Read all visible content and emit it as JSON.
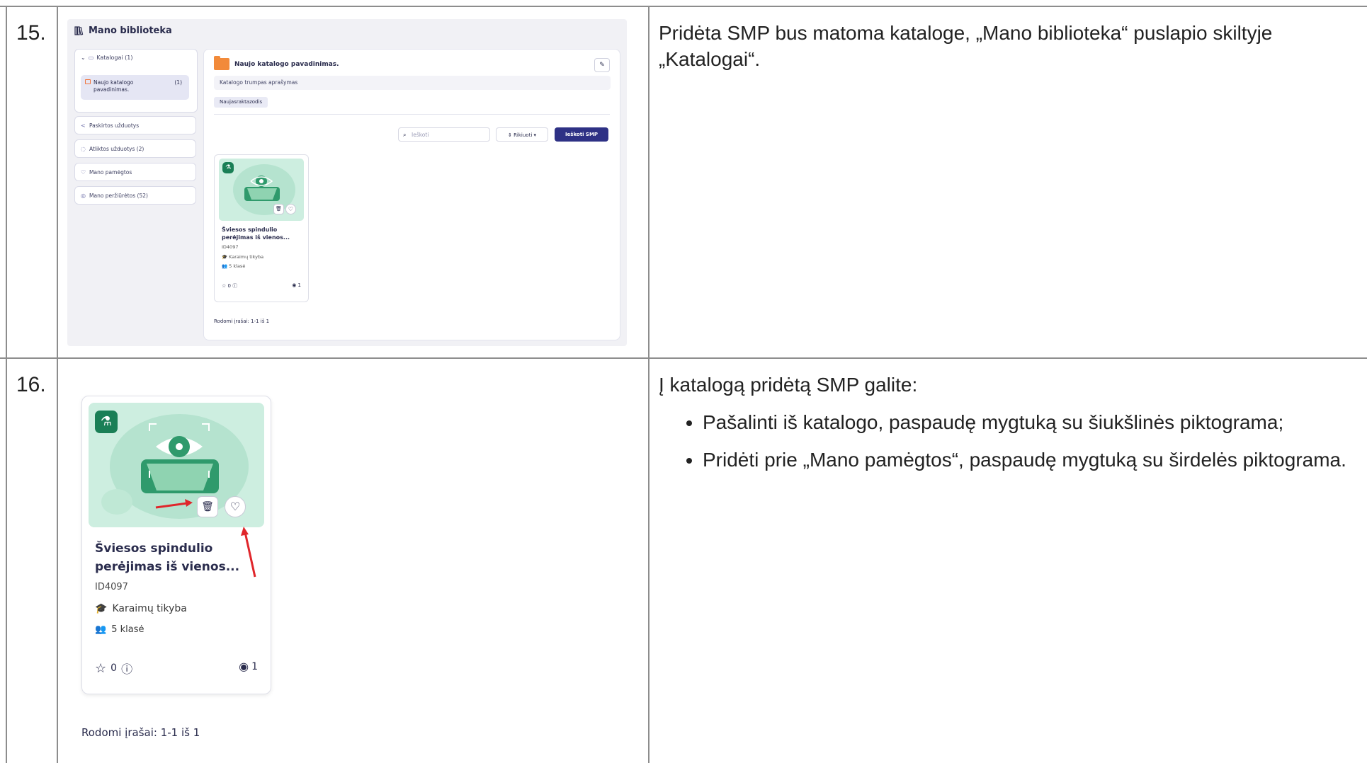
{
  "rows": [
    {
      "number": "15.",
      "description": "Pridėta SMP bus matoma kataloge, „Mano biblioteka“ puslapio skiltyje „Katalogai“."
    },
    {
      "number": "16.",
      "intro": "Į katalogą pridėtą SMP galite:",
      "bullets": [
        "Pašalinti iš katalogo, paspaudę mygtuką su šiukšlinės piktograma;",
        "Pridėti prie „Mano pamėgtos“, paspaudę mygtuką su širdelės piktograma."
      ]
    }
  ],
  "screenshot1": {
    "page_title": "Mano biblioteka",
    "sidebar": {
      "catalogs_header": "Katalogai (1)",
      "selected_catalog": "Naujo katalogo pavadinimas.",
      "selected_catalog_count": "(1)",
      "items": [
        "Paskirtos užduotys",
        "Atliktos užduotys (2)",
        "Mano pamėgtos",
        "Mano peržiūrėtos (52)"
      ]
    },
    "catalog": {
      "name": "Naujo katalogo pavadinimas.",
      "short_description": "Katalogo trumpas aprašymas",
      "keyword": "Naujasraktazodis",
      "search_placeholder": "Ieškoti",
      "sort_label": "Rikiuoti",
      "search_button": "Ieškoti SMP",
      "records_shown": "Rodomi įrašai: 1-1 iš 1"
    },
    "card": {
      "title": "Šviesos spindulio perėjimas iš vienos...",
      "id": "ID4097",
      "subject": "Karaimų tikyba",
      "grade": "5 klasė",
      "stars": "0",
      "views": "1"
    }
  },
  "screenshot2": {
    "card": {
      "title": "Šviesos spindulio perėjimas iš vienos...",
      "id": "ID4097",
      "subject": "Karaimų tikyba",
      "grade": "5 klasė",
      "stars": "0",
      "views": "1"
    },
    "records_shown": "Rodomi įrašai: 1-1 iš 1"
  },
  "colors": {
    "accent": "#2e3185",
    "badge_green": "#1a7f56",
    "image_bg": "#cdeee0",
    "folder_orange": "#f28a3a",
    "arrow_red": "#e0262b",
    "border": "#8d8d8d"
  }
}
